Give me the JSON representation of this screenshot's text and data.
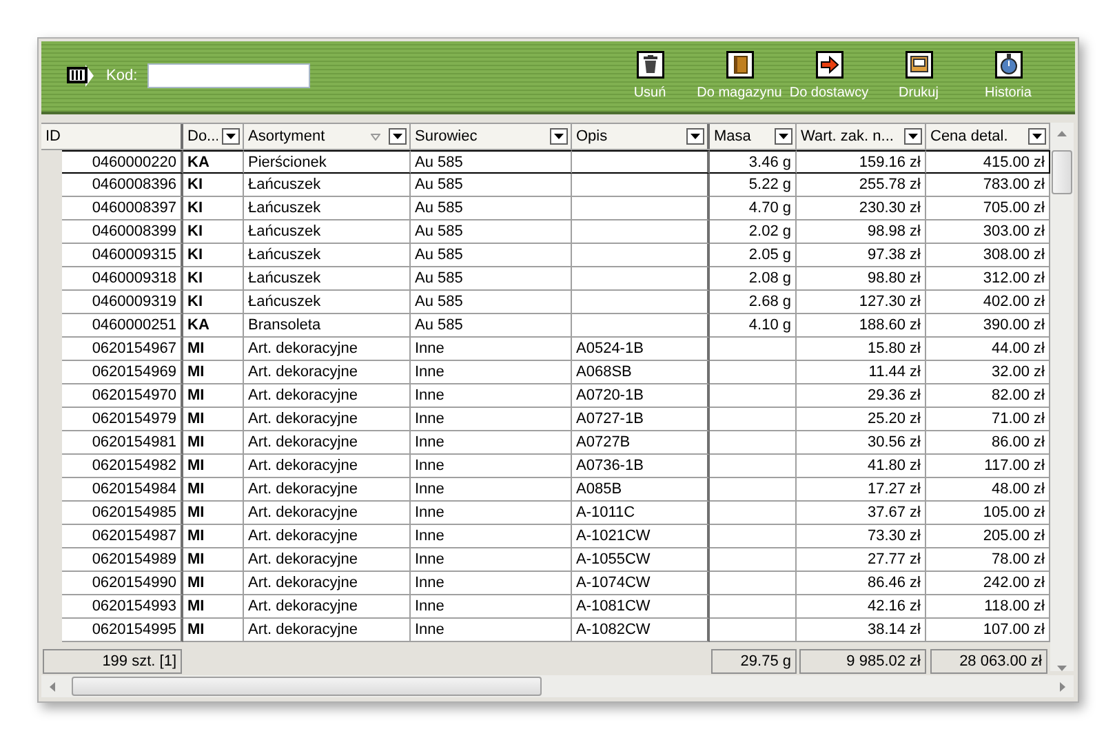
{
  "toolbar": {
    "code_label": "Kod:",
    "buttons": [
      {
        "kind": "trash",
        "label": "Usuń"
      },
      {
        "kind": "book",
        "label": "Do magazynu"
      },
      {
        "kind": "arrow",
        "label": "Do dostawcy"
      },
      {
        "kind": "print",
        "label": "Drukuj"
      },
      {
        "kind": "clock",
        "label": "Historia"
      }
    ]
  },
  "table": {
    "columns": [
      {
        "label": "ID",
        "filter": false,
        "sorted": false
      },
      {
        "label": "Do...",
        "filter": true,
        "sorted": false
      },
      {
        "label": "Asortyment",
        "filter": true,
        "sorted": true
      },
      {
        "label": "Surowiec",
        "filter": true,
        "sorted": false
      },
      {
        "label": "Opis",
        "filter": true,
        "sorted": false
      },
      {
        "label": "Masa",
        "filter": true,
        "sorted": false
      },
      {
        "label": "Wart. zak. n...",
        "filter": true,
        "sorted": false
      },
      {
        "label": "Cena detal.",
        "filter": true,
        "sorted": false
      }
    ],
    "rows": [
      {
        "selected": true,
        "cells": [
          "0460000220",
          "KA",
          "Pierścionek",
          "Au 585",
          "",
          "3.46 g",
          "159.16 zł",
          "415.00 zł"
        ]
      },
      {
        "selected": false,
        "cells": [
          "0460008396",
          "KI",
          "Łańcuszek",
          "Au 585",
          "",
          "5.22 g",
          "255.78 zł",
          "783.00 zł"
        ]
      },
      {
        "selected": false,
        "cells": [
          "0460008397",
          "KI",
          "Łańcuszek",
          "Au 585",
          "",
          "4.70 g",
          "230.30 zł",
          "705.00 zł"
        ]
      },
      {
        "selected": false,
        "cells": [
          "0460008399",
          "KI",
          "Łańcuszek",
          "Au 585",
          "",
          "2.02 g",
          "98.98 zł",
          "303.00 zł"
        ]
      },
      {
        "selected": false,
        "cells": [
          "0460009315",
          "KI",
          "Łańcuszek",
          "Au 585",
          "",
          "2.05 g",
          "97.38 zł",
          "308.00 zł"
        ]
      },
      {
        "selected": false,
        "cells": [
          "0460009318",
          "KI",
          "Łańcuszek",
          "Au 585",
          "",
          "2.08 g",
          "98.80 zł",
          "312.00 zł"
        ]
      },
      {
        "selected": false,
        "cells": [
          "0460009319",
          "KI",
          "Łańcuszek",
          "Au 585",
          "",
          "2.68 g",
          "127.30 zł",
          "402.00 zł"
        ]
      },
      {
        "selected": false,
        "cells": [
          "0460000251",
          "KA",
          "Bransoleta",
          "Au 585",
          "",
          "4.10 g",
          "188.60 zł",
          "390.00 zł"
        ]
      },
      {
        "selected": false,
        "cells": [
          "0620154967",
          "MI",
          "Art. dekoracyjne",
          "Inne",
          "A0524-1B",
          "",
          "15.80 zł",
          "44.00 zł"
        ]
      },
      {
        "selected": false,
        "cells": [
          "0620154969",
          "MI",
          "Art. dekoracyjne",
          "Inne",
          "A068SB",
          "",
          "11.44 zł",
          "32.00 zł"
        ]
      },
      {
        "selected": false,
        "cells": [
          "0620154970",
          "MI",
          "Art. dekoracyjne",
          "Inne",
          "A0720-1B",
          "",
          "29.36 zł",
          "82.00 zł"
        ]
      },
      {
        "selected": false,
        "cells": [
          "0620154979",
          "MI",
          "Art. dekoracyjne",
          "Inne",
          "A0727-1B",
          "",
          "25.20 zł",
          "71.00 zł"
        ]
      },
      {
        "selected": false,
        "cells": [
          "0620154981",
          "MI",
          "Art. dekoracyjne",
          "Inne",
          "A0727B",
          "",
          "30.56 zł",
          "86.00 zł"
        ]
      },
      {
        "selected": false,
        "cells": [
          "0620154982",
          "MI",
          "Art. dekoracyjne",
          "Inne",
          "A0736-1B",
          "",
          "41.80 zł",
          "117.00 zł"
        ]
      },
      {
        "selected": false,
        "cells": [
          "0620154984",
          "MI",
          "Art. dekoracyjne",
          "Inne",
          "A085B",
          "",
          "17.27 zł",
          "48.00 zł"
        ]
      },
      {
        "selected": false,
        "cells": [
          "0620154985",
          "MI",
          "Art. dekoracyjne",
          "Inne",
          "A-1011C",
          "",
          "37.67 zł",
          "105.00 zł"
        ]
      },
      {
        "selected": false,
        "cells": [
          "0620154987",
          "MI",
          "Art. dekoracyjne",
          "Inne",
          "A-1021CW",
          "",
          "73.30 zł",
          "205.00 zł"
        ]
      },
      {
        "selected": false,
        "cells": [
          "0620154989",
          "MI",
          "Art. dekoracyjne",
          "Inne",
          "A-1055CW",
          "",
          "27.77 zł",
          "78.00 zł"
        ]
      },
      {
        "selected": false,
        "cells": [
          "0620154990",
          "MI",
          "Art. dekoracyjne",
          "Inne",
          "A-1074CW",
          "",
          "86.46 zł",
          "242.00 zł"
        ]
      },
      {
        "selected": false,
        "cells": [
          "0620154993",
          "MI",
          "Art. dekoracyjne",
          "Inne",
          "A-1081CW",
          "",
          "42.16 zł",
          "118.00 zł"
        ]
      },
      {
        "selected": false,
        "cells": [
          "0620154995",
          "MI",
          "Art. dekoracyjne",
          "Inne",
          "A-1082CW",
          "",
          "38.14 zł",
          "107.00 zł"
        ]
      }
    ]
  },
  "footer": {
    "count": "199 szt. [1]",
    "masa_total": "29.75 g",
    "wart_total": "9 985.02 zł",
    "cena_total": "28 063.00 zł"
  }
}
